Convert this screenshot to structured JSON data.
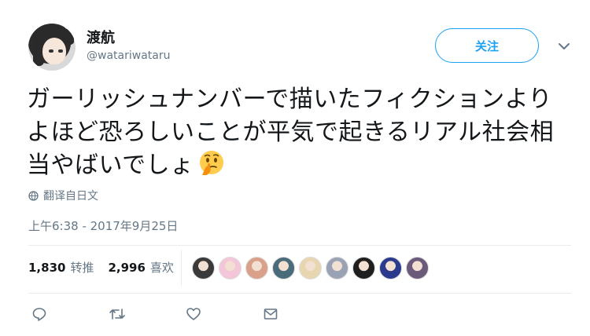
{
  "author": {
    "display_name": "渡航",
    "handle": "@watariwataru"
  },
  "follow_label": "关注",
  "tweet": {
    "text": "ガーリッシュナンバーで描いたフィクションよりよほど恐ろしいことが平気で起きるリアル社会相当やばいでしょ",
    "emoji": "thinking-face"
  },
  "translate_label": "翻译自日文",
  "timestamp": "上午6:38 - 2017年9月25日",
  "stats": {
    "retweets": "1,830",
    "retweets_label": "转推",
    "likes": "2,996",
    "likes_label": "喜欢"
  },
  "liker_avatar_colors": [
    "#3a3a3a",
    "#f4c6d9",
    "#d9a08a",
    "#4a6b7a",
    "#e7d6b0",
    "#9aa3b5",
    "#1f1f1f",
    "#2b3a8c",
    "#6b5a7a"
  ],
  "icons": [
    "reply-icon",
    "retweet-icon",
    "like-icon",
    "message-icon"
  ],
  "colors": {
    "accent": "#1da1f2",
    "muted": "#657786",
    "text": "#14171a"
  }
}
